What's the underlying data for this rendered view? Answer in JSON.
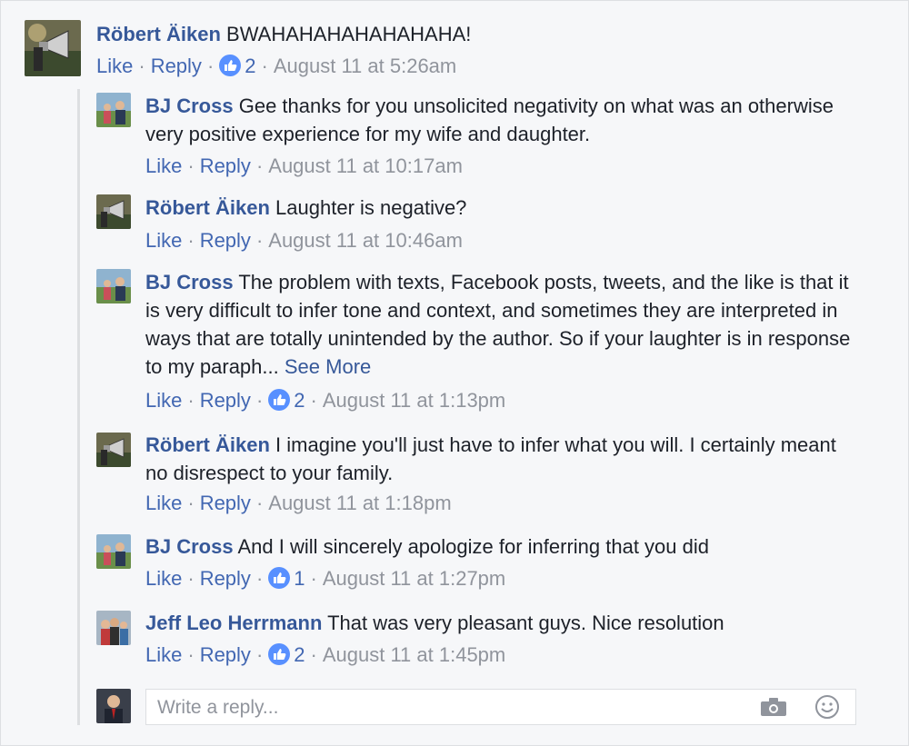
{
  "top_comment": {
    "author": "Röbert Äiken",
    "text": "BWAHAHAHAHAHAHAHA!",
    "like_label": "Like",
    "reply_label": "Reply",
    "like_count": "2",
    "time": "August 11 at 5:26am",
    "avatar_icon": "megaphone-avatar"
  },
  "replies": [
    {
      "author": "BJ Cross",
      "text": "Gee thanks for you unsolicited negativity on what was an otherwise very positive experience for my wife and daughter.",
      "like_label": "Like",
      "reply_label": "Reply",
      "time": "August 11 at 10:17am"
    },
    {
      "author": "Röbert Äiken",
      "text": "Laughter is negative?",
      "like_label": "Like",
      "reply_label": "Reply",
      "time": "August 11 at 10:46am"
    },
    {
      "author": "BJ Cross",
      "text": "The problem with texts, Facebook posts, tweets, and the like is that it is very difficult to infer tone and context, and sometimes they are interpreted in ways that are totally unintended by the author. So if your laughter is in response to my paraph...",
      "see_more": "See More",
      "like_label": "Like",
      "reply_label": "Reply",
      "like_count": "2",
      "time": "August 11 at 1:13pm"
    },
    {
      "author": "Röbert Äiken",
      "text": "I imagine you'll just have to infer what you will. I certainly meant no disrespect to your family.",
      "like_label": "Like",
      "reply_label": "Reply",
      "time": "August 11 at 1:18pm"
    },
    {
      "author": "BJ Cross",
      "text": "And I will sincerely apologize for inferring that you did",
      "like_label": "Like",
      "reply_label": "Reply",
      "like_count": "1",
      "time": "August 11 at 1:27pm"
    },
    {
      "author": "Jeff Leo Herrmann",
      "text": "That was very pleasant guys. Nice resolution",
      "like_label": "Like",
      "reply_label": "Reply",
      "like_count": "2",
      "time": "August 11 at 1:45pm"
    }
  ],
  "reply_box": {
    "placeholder": "Write a reply...",
    "camera_icon": "camera-icon",
    "emoji_icon": "smiley-icon"
  },
  "colors": {
    "link": "#365899",
    "action": "#4267b2",
    "meta": "#90949c",
    "like_badge": "#5890ff"
  }
}
